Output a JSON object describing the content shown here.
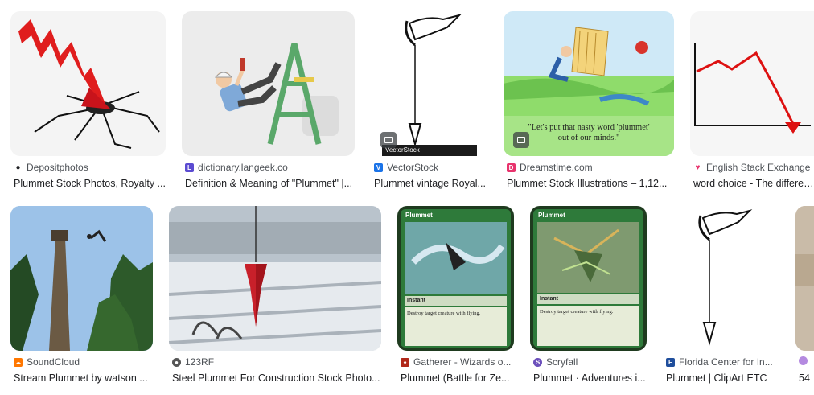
{
  "row1": [
    {
      "source": "Depositphotos",
      "title": "Plummet Stock Photos, Royalty ...",
      "favicon_color": "#202124"
    },
    {
      "source": "dictionary.langeek.co",
      "title": "Definition & Meaning of \"Plummet\" |...",
      "favicon_color": "#5b4bd1"
    },
    {
      "source": "VectorStock",
      "title": "Plummet vintage Royal...",
      "favicon_color": "#1a73e8",
      "watermark": "VectorStock"
    },
    {
      "source": "Dreamstime.com",
      "title": "Plummet Stock Illustrations – 1,12...",
      "favicon_color": "#e8336d",
      "caption_line1": "\"Let's put that nasty word 'plummet'",
      "caption_line2": "out of our minds.\""
    },
    {
      "source": "English Stack Exchange",
      "title": "word choice - The differenc",
      "favicon_color": "#e8336d"
    }
  ],
  "row2": [
    {
      "source": "SoundCloud",
      "title": "Stream Plummet by watson ...",
      "favicon_color": "#ff7700"
    },
    {
      "source": "123RF",
      "title": "Steel Plummet For Construction Stock Photo...",
      "favicon_color": "#555555"
    },
    {
      "source": "Gatherer - Wizards o...",
      "title": "Plummet (Battle for Ze...",
      "favicon_color": "#b0281a",
      "card_name": "Plummet",
      "card_type": "Instant",
      "card_text": "Destroy target creature with flying."
    },
    {
      "source": "Scryfall",
      "title": "Plummet · Adventures i...",
      "favicon_color": "#6b4fbb",
      "card_name": "Plummet",
      "card_type": "Instant",
      "card_text": "Destroy target creature with flying."
    },
    {
      "source": "Florida Center for In...",
      "title": "Plummet | ClipArt ETC",
      "favicon_color": "#1f4e9c"
    },
    {
      "source": "",
      "title": "54",
      "favicon_color": "#b48ae0"
    }
  ]
}
